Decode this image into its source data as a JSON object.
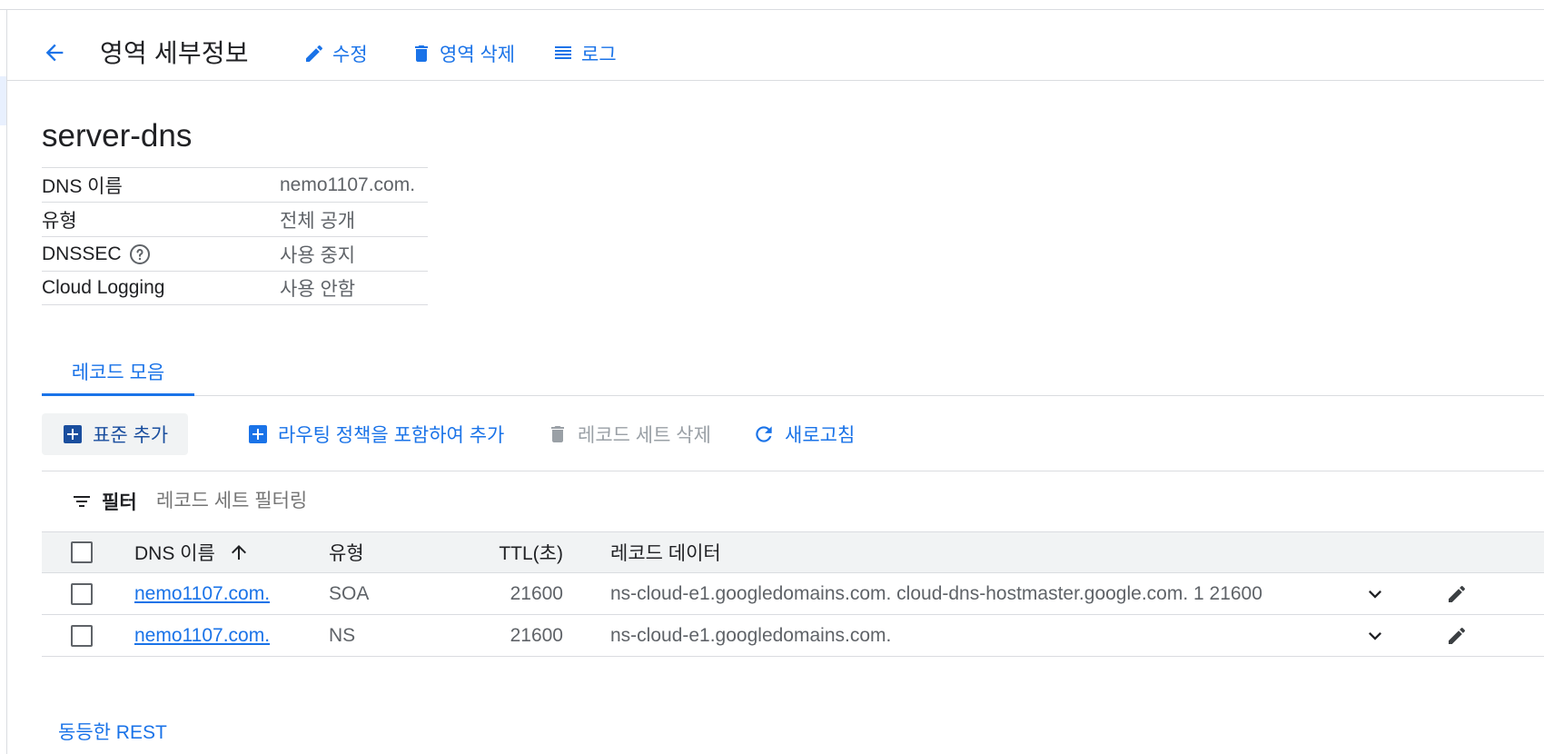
{
  "header": {
    "title": "영역 세부정보",
    "edit_label": "수정",
    "delete_zone_label": "영역 삭제",
    "logs_label": "로그"
  },
  "zone": {
    "name": "server-dns",
    "details": [
      {
        "label": "DNS 이름",
        "value": "nemo1107.com."
      },
      {
        "label": "유형",
        "value": "전체 공개"
      },
      {
        "label": "DNSSEC",
        "value": "사용 중지"
      },
      {
        "label": "Cloud Logging",
        "value": "사용 안함"
      }
    ]
  },
  "tabs": [
    {
      "label": "레코드 모음",
      "active": true
    }
  ],
  "toolbar": {
    "add_standard": "표준 추가",
    "add_with_routing": "라우팅 정책을 포함하여 추가",
    "delete_record_sets": "레코드 세트 삭제",
    "refresh": "새로고침"
  },
  "filter": {
    "label": "필터",
    "placeholder": "레코드 세트 필터링"
  },
  "table": {
    "columns": {
      "name": "DNS 이름",
      "type": "유형",
      "ttl": "TTL(초)",
      "data": "레코드 데이터"
    },
    "rows": [
      {
        "name": "nemo1107.com.",
        "type": "SOA",
        "ttl": "21600",
        "data": "ns-cloud-e1.googledomains.com. cloud-dns-hostmaster.google.com. 1 21600"
      },
      {
        "name": "nemo1107.com.",
        "type": "NS",
        "ttl": "21600",
        "data": "ns-cloud-e1.googledomains.com."
      }
    ]
  },
  "footer": {
    "rest_link": "동등한 REST"
  },
  "colors": {
    "accent": "#1a73e8",
    "text": "#202124",
    "secondary_text": "#5f6368",
    "divider": "#dadce0",
    "header_bg": "#f1f3f4",
    "disabled": "#9aa0a6"
  }
}
